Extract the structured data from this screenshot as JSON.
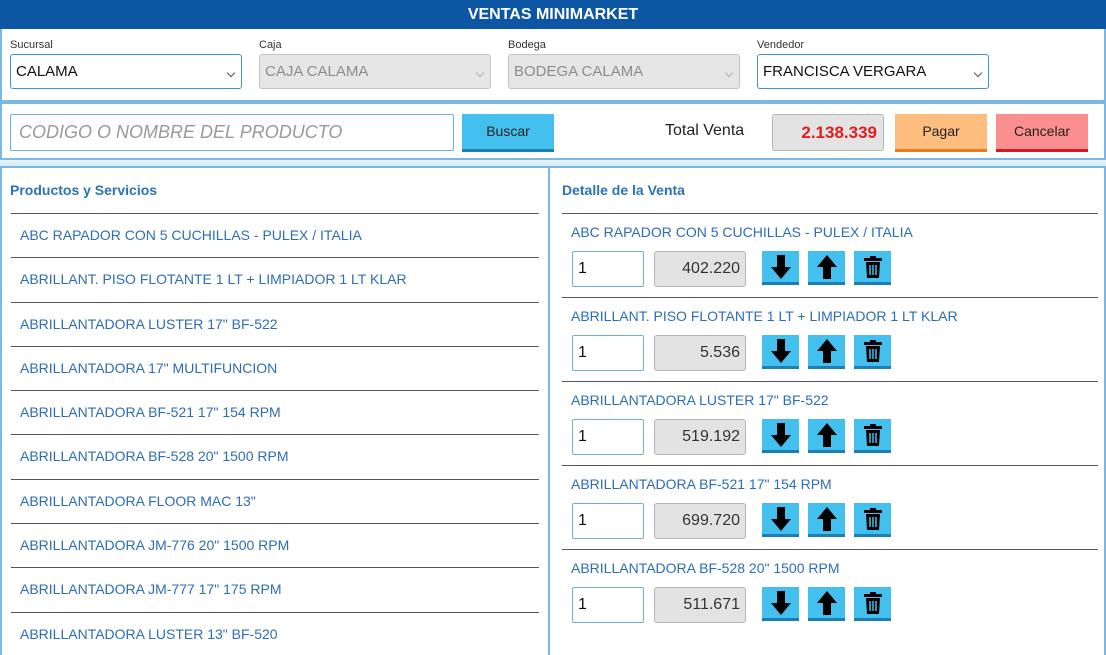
{
  "title": "VENTAS MINIMARKET",
  "selectors": {
    "sucursal": {
      "label": "Sucursal",
      "value": "CALAMA"
    },
    "caja": {
      "label": "Caja",
      "value": "CAJA CALAMA"
    },
    "bodega": {
      "label": "Bodega",
      "value": "BODEGA CALAMA"
    },
    "vendedor": {
      "label": "Vendedor",
      "value": "FRANCISCA VERGARA"
    }
  },
  "search": {
    "placeholder": "CODIGO O NOMBRE DEL PRODUCTO",
    "button": "Buscar"
  },
  "total": {
    "label": "Total Venta",
    "value": "2.138.339"
  },
  "actions": {
    "pay": "Pagar",
    "cancel": "Cancelar"
  },
  "products": {
    "title": "Productos y Servicios",
    "items": [
      "ABC RAPADOR CON 5 CUCHILLAS - PULEX / ITALIA",
      "ABRILLANT. PISO FLOTANTE 1 LT + LIMPIADOR 1 LT KLAR",
      "ABRILLANTADORA LUSTER 17\" BF-522",
      "ABRILLANTADORA 17\" MULTIFUNCION",
      "ABRILLANTADORA BF-521 17\" 154 RPM",
      "ABRILLANTADORA BF-528 20\" 1500 RPM",
      "ABRILLANTADORA FLOOR MAC 13\"",
      "ABRILLANTADORA JM-776 20\" 1500 RPM",
      "ABRILLANTADORA JM-777 17\" 175 RPM",
      "ABRILLANTADORA LUSTER 13\" BF-520"
    ]
  },
  "detail": {
    "title": "Detalle de la Venta",
    "items": [
      {
        "name": "ABC RAPADOR CON 5 CUCHILLAS - PULEX / ITALIA",
        "qty": "1",
        "price": "402.220"
      },
      {
        "name": "ABRILLANT. PISO FLOTANTE 1 LT + LIMPIADOR 1 LT KLAR",
        "qty": "1",
        "price": "5.536"
      },
      {
        "name": "ABRILLANTADORA LUSTER 17\" BF-522",
        "qty": "1",
        "price": "519.192"
      },
      {
        "name": "ABRILLANTADORA BF-521 17\" 154 RPM",
        "qty": "1",
        "price": "699.720"
      },
      {
        "name": "ABRILLANTADORA BF-528 20\" 1500 RPM",
        "qty": "1",
        "price": "511.671"
      }
    ],
    "icons": {
      "decrease": "arrow-down-icon",
      "increase": "arrow-up-icon",
      "remove": "trash-icon"
    }
  },
  "colors": {
    "header": "#0d56a4",
    "accent": "#44c0ee",
    "pay": "#fdbd7f",
    "cancel": "#fb8f8f",
    "total": "#e31d1d",
    "link": "#2c6db6"
  }
}
